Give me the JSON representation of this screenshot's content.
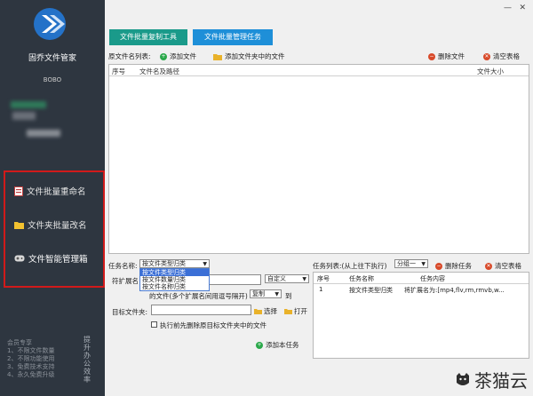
{
  "app": {
    "name": "固乔文件管家",
    "user": "BOBO"
  },
  "window": {
    "minimize": "—",
    "close": "✕"
  },
  "sidebar": {
    "nav": [
      {
        "label": "文件批量重命名",
        "icon": "rename-file-icon"
      },
      {
        "label": "文件夹批量改名",
        "icon": "folder-icon"
      },
      {
        "label": "文件智能管理箱",
        "icon": "gamepad-icon"
      }
    ],
    "promo_lines": [
      "会员专享",
      "1、不限文件数量",
      "2、不限功能使用",
      "3、免费技术支持",
      "4、永久免费升级"
    ],
    "promo_vertical": "提升办公效率"
  },
  "tabs": [
    "文件批量复制工具",
    "文件批量管理任务"
  ],
  "file_list": {
    "label": "原文件名列表:",
    "add_file": "添加文件",
    "add_folder_files": "添加文件夹中的文件",
    "delete_file": "删除文件",
    "clear_table": "清空表格",
    "columns": [
      "序号",
      "文件名及路径",
      "文件大小"
    ]
  },
  "task_form": {
    "task_name_label": "任务名称:",
    "task_name_value": "按文件类型归类",
    "task_options": [
      "按文件类型归类",
      "按文件数量归类",
      "按文件名称归类"
    ],
    "ext_label": "符扩展名",
    "ext_note": "的文件(多个扩展名间用逗号隔开)",
    "custom_select": "自定义",
    "copy_select": "复制",
    "to_text": "到",
    "target_folder_label": "目标文件夹:",
    "choose_btn": "选择",
    "open_btn": "打开",
    "clear_first_label": "执行前先删除原目标文件夹中的文件",
    "add_task_btn": "添加本任务"
  },
  "task_list": {
    "label": "任务列表:(从上往下执行)",
    "group_select": "分组一",
    "delete_task": "删除任务",
    "clear_table": "清空表格",
    "columns": [
      "序号",
      "任务名称",
      "任务内容"
    ],
    "rows": [
      {
        "no": "1",
        "name": "按文件类型归类",
        "content": "将扩展名为:[mp4,flv,rm,rmvb,w..."
      }
    ]
  },
  "watermark": "茶猫云",
  "colors": {
    "sidebar_bg": "#2e3640",
    "tab1": "#1a9a8a",
    "tab2": "#1e8fd8",
    "highlight_border": "#d11a1a",
    "add_green": "#2aa84a",
    "delete_red": "#d84a2a"
  }
}
